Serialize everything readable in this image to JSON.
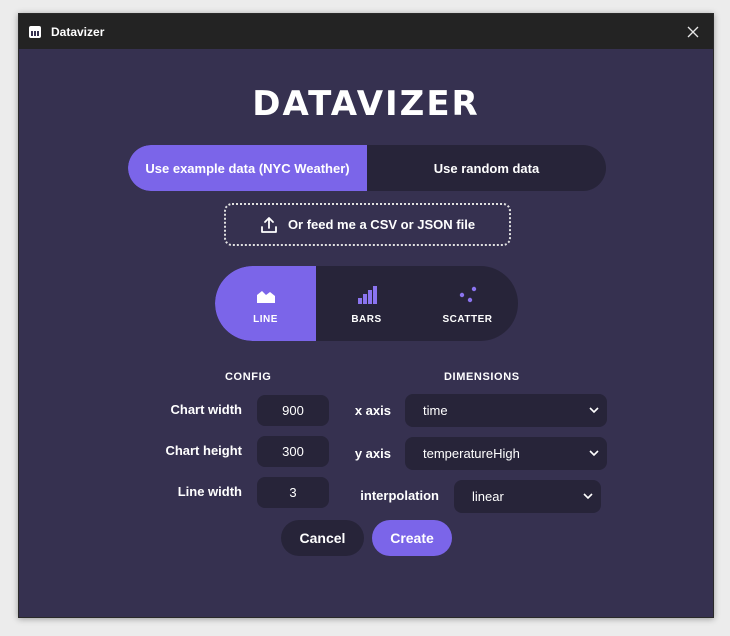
{
  "window": {
    "title": "Datavizer",
    "app_icon": "chart-bars-icon",
    "close_icon": "close-icon"
  },
  "brand": {
    "title": "DATAVIZER"
  },
  "data_source": {
    "options": [
      {
        "label": "Use example data (NYC Weather)",
        "selected": true
      },
      {
        "label": "Use random data",
        "selected": false
      }
    ],
    "upload_label": "Or feed me a CSV or JSON file",
    "upload_icon": "upload-icon"
  },
  "chart_types": [
    {
      "label": "LINE",
      "icon": "line-area-chart-icon",
      "selected": true
    },
    {
      "label": "BARS",
      "icon": "bar-chart-icon",
      "selected": false
    },
    {
      "label": "SCATTER",
      "icon": "scatter-chart-icon",
      "selected": false
    }
  ],
  "config": {
    "heading": "CONFIG",
    "chart_width": {
      "label": "Chart width",
      "value": "900"
    },
    "chart_height": {
      "label": "Chart height",
      "value": "300"
    },
    "line_width": {
      "label": "Line width",
      "value": "3"
    }
  },
  "dimensions": {
    "heading": "DIMENSIONS",
    "x_axis": {
      "label": "x axis",
      "value": "time"
    },
    "y_axis": {
      "label": "y axis",
      "value": "temperatureHigh"
    },
    "interpolation": {
      "label": "interpolation",
      "value": "linear"
    }
  },
  "actions": {
    "cancel": "Cancel",
    "create": "Create"
  },
  "colors": {
    "accent": "#7b65e9",
    "background": "#363150",
    "control": "#272439",
    "titlebar": "#232323"
  }
}
